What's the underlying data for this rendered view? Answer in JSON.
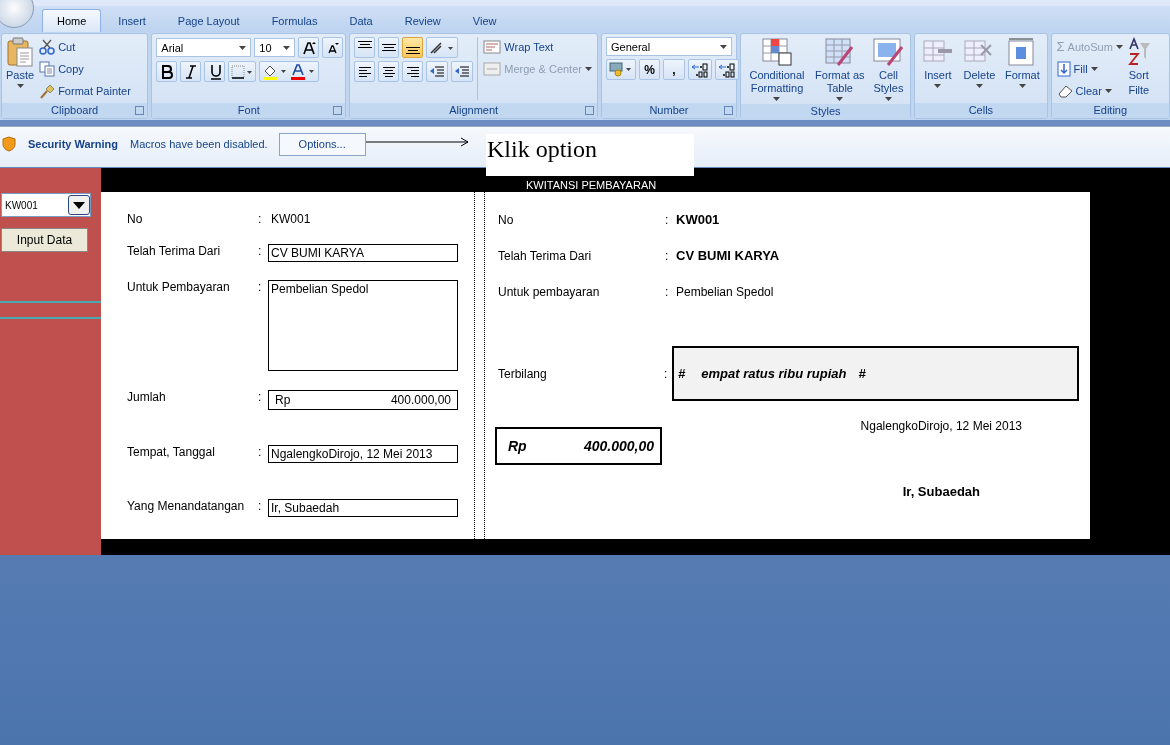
{
  "tabs": [
    {
      "label": "Home",
      "selected": true
    },
    {
      "label": "Insert",
      "selected": false
    },
    {
      "label": "Page Layout",
      "selected": false
    },
    {
      "label": "Formulas",
      "selected": false
    },
    {
      "label": "Data",
      "selected": false
    },
    {
      "label": "Review",
      "selected": false
    },
    {
      "label": "View",
      "selected": false
    }
  ],
  "ribbon": {
    "clipboard": {
      "group": "Clipboard",
      "paste": "Paste",
      "cut": "Cut",
      "copy": "Copy",
      "format_painter": "Format Painter"
    },
    "font": {
      "group": "Font",
      "font_name": "Arial",
      "font_size": "10"
    },
    "alignment": {
      "group": "Alignment",
      "vertical_align": [
        {
          "selected": false
        },
        {
          "selected": false
        },
        {
          "selected": true
        }
      ],
      "wrap_text": {
        "label": "Wrap Text",
        "disabled": false
      },
      "merge_center": {
        "label": "Merge & Center",
        "disabled": true
      }
    },
    "number": {
      "group": "Number",
      "format": "General",
      "percent": "%",
      "comma": ","
    },
    "styles": {
      "group": "Styles",
      "buttons": [
        {
          "kind": "conditional",
          "label": "Conditional Formatting"
        },
        {
          "kind": "table",
          "label": "Format as Table"
        },
        {
          "kind": "cellstyles",
          "label": "Cell Styles"
        }
      ]
    },
    "cells": {
      "group": "Cells",
      "buttons": [
        {
          "kind": "insert",
          "label": "Insert"
        },
        {
          "kind": "delete",
          "label": "Delete"
        },
        {
          "kind": "format",
          "label": "Format"
        }
      ]
    },
    "editing": {
      "group": "Editing",
      "autosum_symbol": "Σ",
      "autosum": {
        "label": "AutoSum",
        "disabled": true
      },
      "fill": {
        "label": "Fill",
        "disabled": false
      },
      "clear": {
        "label": "Clear",
        "disabled": false
      },
      "sort_filter": [
        "Sort",
        "Filte"
      ]
    }
  },
  "security_bar": {
    "title": "Security Warning",
    "message": "Macros have been disabled.",
    "button": "Options...",
    "callout": "Klik option"
  },
  "sheet": {
    "combo_value": "KW001",
    "input_button": "Input Data",
    "form": [
      {
        "kind": "text",
        "label": "No",
        "colon": ":",
        "value": "KW001"
      },
      {
        "kind": "field",
        "label": "Telah Terima Dari",
        "colon": ":",
        "value": "CV BUMI KARYA"
      },
      {
        "kind": "area",
        "label": "Untuk Pembayaran",
        "colon": ":",
        "value": "Pembelian Spedol"
      },
      {
        "kind": "amount",
        "label": "Jumlah",
        "colon": ":",
        "currency": "Rp",
        "value": "400.000,00"
      },
      {
        "kind": "field",
        "label": "Tempat, Tanggal",
        "colon": ":",
        "value": "NgalengkoDirojo, 12 Mei 2013"
      },
      {
        "kind": "field",
        "label": "Yang Menandatangan",
        "colon": ":",
        "value": "Ir, Subaedah"
      }
    ],
    "receipt": {
      "title": "KWITANSI PEMBAYARAN",
      "rows": [
        {
          "label": "No",
          "colon": ":",
          "value": "KW001"
        },
        {
          "label": "Telah Terima Dari",
          "colon": ":",
          "value": "CV BUMI KARYA"
        },
        {
          "label": "Untuk pembayaran",
          "colon": ":",
          "value": "Pembelian Spedol"
        }
      ],
      "spelled": {
        "label": "Terbilang",
        "colon": ":",
        "mark_open": "#",
        "words": "empat ratus ribu rupiah",
        "mark_close": "#"
      },
      "place_date": "NgalengkoDirojo, 12 Mei 2013",
      "amount": {
        "currency": "Rp",
        "value": "400.000,00"
      },
      "signer": "Ir, Subaedah"
    }
  }
}
